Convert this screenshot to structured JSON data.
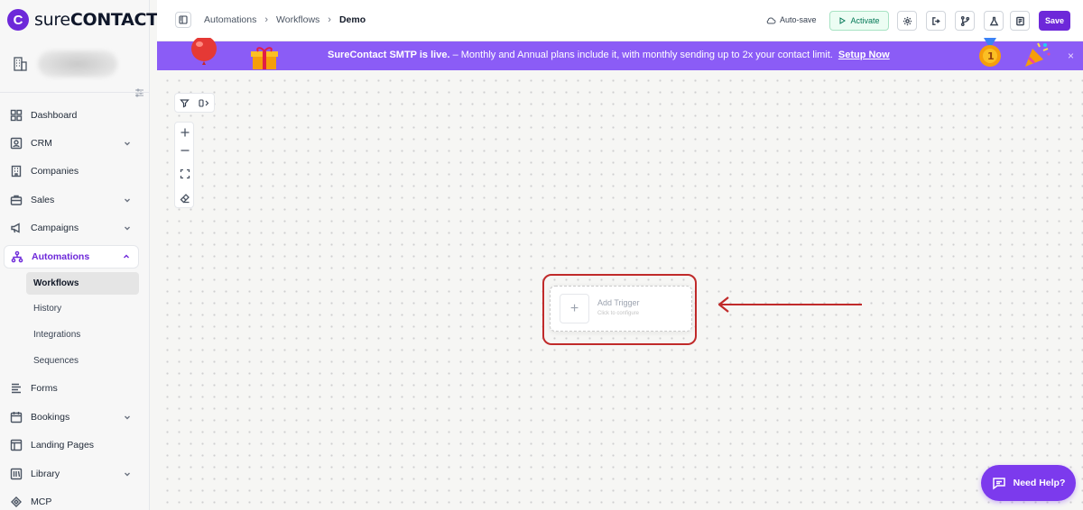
{
  "brand": {
    "name_light": "sure",
    "name_bold": "CONTACT"
  },
  "nav": {
    "items": [
      {
        "label": "Dashboard"
      },
      {
        "label": "CRM"
      },
      {
        "label": "Companies"
      },
      {
        "label": "Sales"
      },
      {
        "label": "Campaigns"
      },
      {
        "label": "Automations"
      },
      {
        "label": "Forms"
      },
      {
        "label": "Bookings"
      },
      {
        "label": "Landing Pages"
      },
      {
        "label": "Library"
      },
      {
        "label": "MCP"
      }
    ],
    "automation_sub": [
      {
        "label": "Workflows"
      },
      {
        "label": "History"
      },
      {
        "label": "Integrations"
      },
      {
        "label": "Sequences"
      }
    ]
  },
  "breadcrumb": {
    "first": "Automations",
    "second": "Workflows",
    "current": "Demo"
  },
  "toolbar": {
    "autosave": "Auto-save",
    "activate": "Activate",
    "save": "Save"
  },
  "banner": {
    "title": "SureContact SMTP is live.",
    "message": " – Monthly and Annual plans include it, with monthly sending up to 2x your contact limit.",
    "link": "Setup Now",
    "close": "×"
  },
  "trigger": {
    "title": "Add Trigger",
    "subtitle": "Click to configure",
    "plus": "+"
  },
  "help": {
    "label": "Need Help?"
  },
  "colors": {
    "brand": "#6d28d9",
    "banner": "#8b5cf6",
    "highlight": "#c02a2a",
    "activate": "#047857"
  }
}
